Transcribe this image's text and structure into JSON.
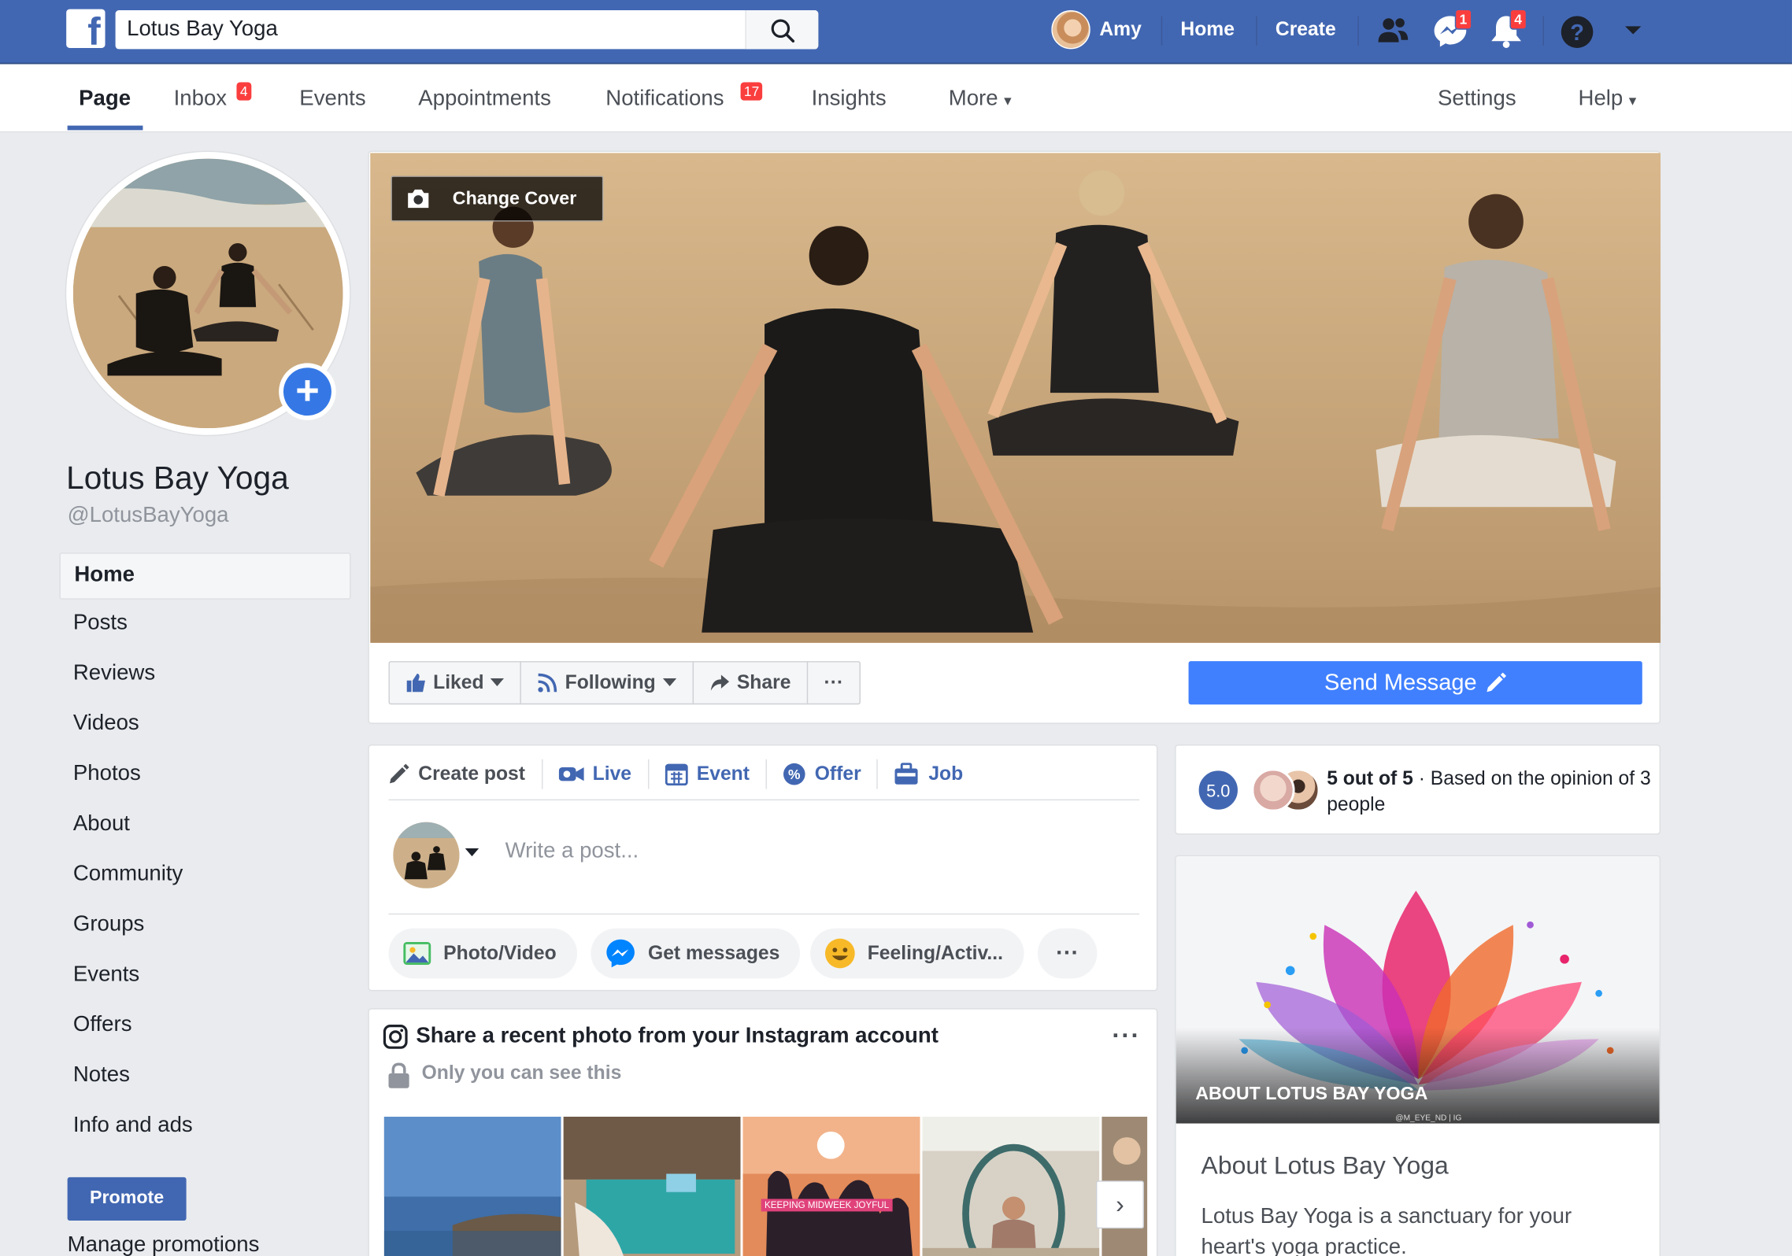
{
  "topbar": {
    "search_value": "Lotus Bay Yoga",
    "user_name": "Amy",
    "home_label": "Home",
    "create_label": "Create",
    "messenger_badge": "1",
    "notifications_badge": "4"
  },
  "page_nav": {
    "items": [
      {
        "label": "Page",
        "badge": ""
      },
      {
        "label": "Inbox",
        "badge": "4"
      },
      {
        "label": "Events",
        "badge": ""
      },
      {
        "label": "Appointments",
        "badge": ""
      },
      {
        "label": "Notifications",
        "badge": "17"
      },
      {
        "label": "Insights",
        "badge": ""
      },
      {
        "label": "More",
        "badge": ""
      }
    ],
    "settings_label": "Settings",
    "help_label": "Help"
  },
  "profile": {
    "name": "Lotus Bay Yoga",
    "handle": "@LotusBayYoga"
  },
  "side_nav": {
    "items": [
      "Home",
      "Posts",
      "Reviews",
      "Videos",
      "Photos",
      "About",
      "Community",
      "Groups",
      "Events",
      "Offers",
      "Notes",
      "Info and ads"
    ],
    "promote_label": "Promote",
    "manage_promotions_label": "Manage promotions"
  },
  "cover": {
    "change_cover_label": "Change Cover",
    "actions": {
      "liked": "Liked",
      "following": "Following",
      "share": "Share",
      "more": "···"
    },
    "send_message_label": "Send Message"
  },
  "composer": {
    "tabs": [
      "Create post",
      "Live",
      "Event",
      "Offer",
      "Job"
    ],
    "placeholder": "Write a post...",
    "pills": [
      "Photo/Video",
      "Get messages",
      "Feeling/Activ...",
      "···"
    ]
  },
  "instagram": {
    "title": "Share a recent photo from your Instagram account",
    "subtitle": "Only you can see this",
    "more": "···",
    "banner_text": "KEEPING MIDWEEK JOYFUL",
    "next": "›"
  },
  "rating": {
    "score": "5.0",
    "headline": "5 out of 5",
    "detail": " · Based on the opinion of 3 people"
  },
  "about": {
    "image_title": "ABOUT LOTUS BAY YOGA",
    "watermark": "@M_EYE_ND | IG",
    "heading": "About Lotus Bay Yoga",
    "description": "Lotus Bay Yoga is a sanctuary for your heart's yoga practice."
  },
  "colors": {
    "brand_blue": "#4267b2",
    "send_message_blue": "#4080ff",
    "badge_red": "#fa3e3e",
    "page_bg": "#e9ebee"
  }
}
